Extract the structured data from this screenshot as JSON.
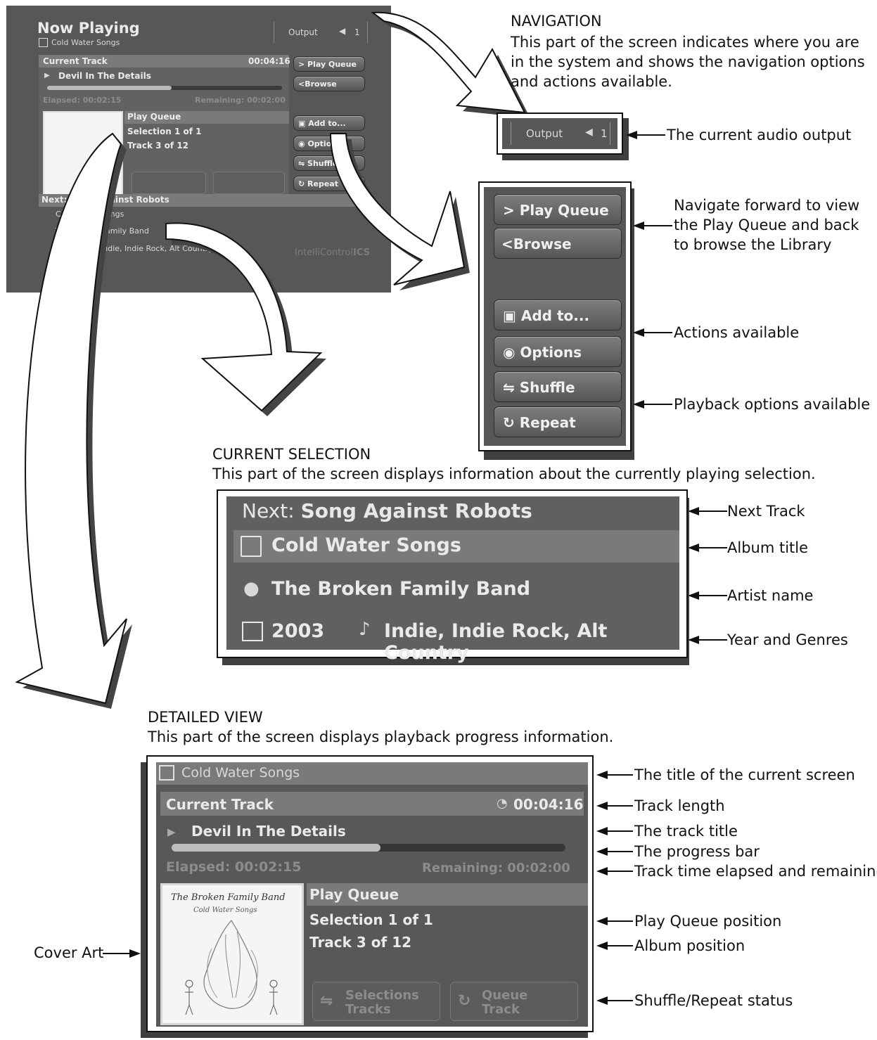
{
  "screen": {
    "title": "Now Playing",
    "subtitle": "Cold Water Songs",
    "output_label": "Output",
    "output_value": "1",
    "current_track_label": "Current Track",
    "track_length": "00:04:16",
    "track_title": "Devil In The Details",
    "elapsed": "Elapsed: 00:02:15",
    "remaining": "Remaining: 00:02:00",
    "progress_fraction": 0.53,
    "play_queue_label": "Play Queue",
    "selection": "Selection 1 of 1",
    "track_pos": "Track 3 of 12",
    "shuffle_status": "Selections\nTracks",
    "shuffle_line1": "Selections",
    "shuffle_line2": "Tracks",
    "repeat_line1": "Queue",
    "repeat_line2": "Track",
    "next_track_prefix": "Next:",
    "next_track": "Song Against Robots",
    "album": "Cold Water Songs",
    "artist": "The Broken Family Band",
    "year": "2003",
    "genres": "Indie, Indie Rock, Alt Country",
    "brand": "IntelliControl",
    "brand_bold": "ICS",
    "cover_title": "The Broken Family Band",
    "cover_subtitle": "Cold Water Songs",
    "buttons": {
      "play_queue": "Play Queue",
      "browse": "Browse",
      "add_to": "Add to...",
      "options": "Options",
      "shuffle": "Shuffle",
      "repeat": "Repeat"
    }
  },
  "navigation": {
    "heading": "NAVIGATION",
    "body": "This part of the screen indicates where you are in the system and shows the navigation options and actions available.",
    "callouts": {
      "output": "The current audio output",
      "navigate": "Navigate forward to view the Play Queue and back to browse the Library",
      "actions": "Actions available",
      "playback": "Playback options available"
    }
  },
  "current_selection": {
    "heading": "CURRENT SELECTION",
    "body": "This part of the screen displays information about the currently playing selection.",
    "callouts": {
      "next": "Next Track",
      "album": "Album title",
      "artist": "Artist name",
      "year_genres": "Year and Genres"
    }
  },
  "detailed_view": {
    "heading": "DETAILED VIEW",
    "body": "This part of the screen displays playback progress information.",
    "callouts": {
      "screen_title": "The title of the current screen",
      "track_length": "Track length",
      "track_title": "The track title",
      "progress_bar": "The progress bar",
      "elapsed_remaining": "Track time elapsed and remaining",
      "queue_position": "Play Queue position",
      "album_position": "Album position",
      "shuffle_repeat": "Shuffle/Repeat status",
      "cover_art": "Cover Art"
    }
  },
  "colors": {
    "ui_dark": "#5a5a5a",
    "ui_bar": "#7a7a7a",
    "text_light": "#eaeaea"
  }
}
